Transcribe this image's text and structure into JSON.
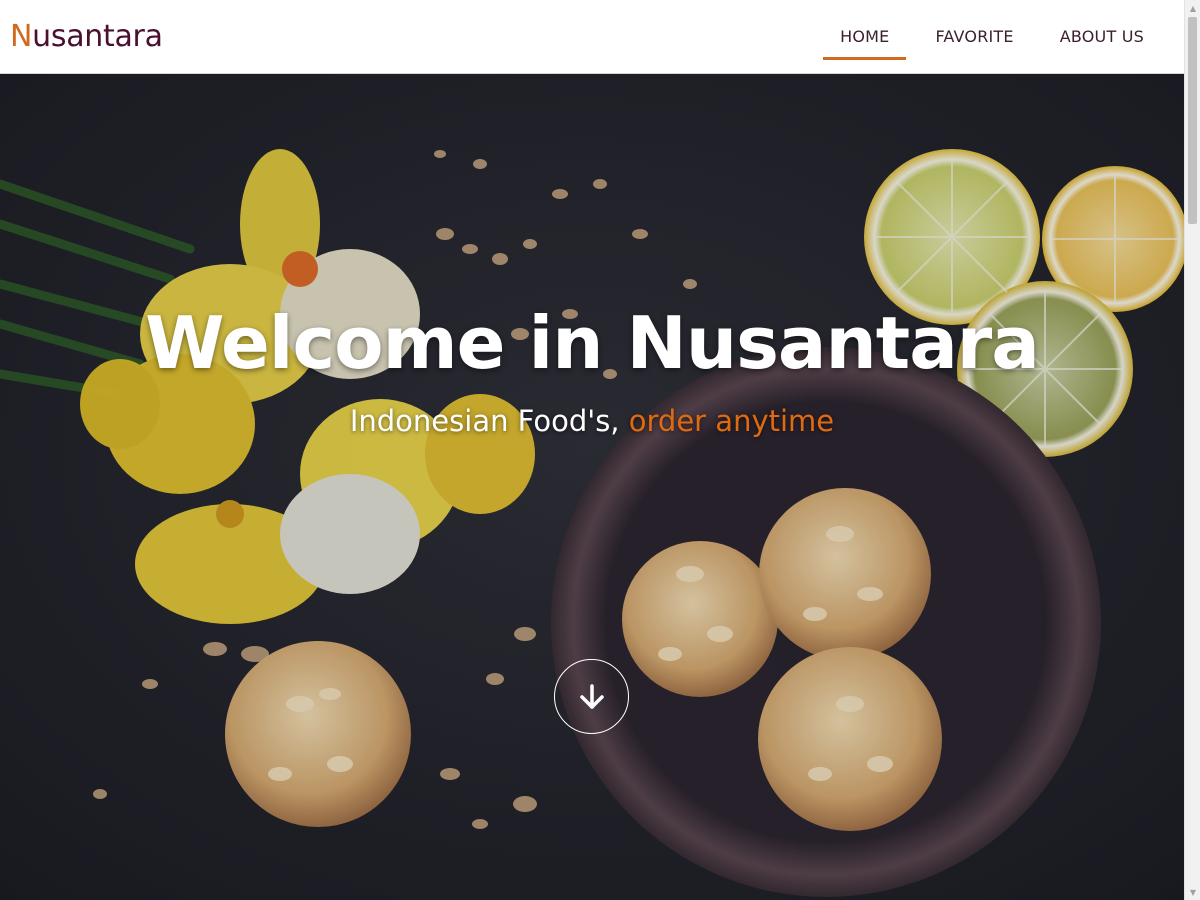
{
  "header": {
    "logo": {
      "first_letter": "N",
      "rest": "usantara"
    },
    "nav": [
      {
        "label": "HOME",
        "active": true
      },
      {
        "label": "FAVORITE",
        "active": false
      },
      {
        "label": "ABOUT US",
        "active": false
      }
    ]
  },
  "hero": {
    "title": "Welcome in Nusantara",
    "subtitle": "Indonesian Food's,",
    "subtitle_accent": "order anytime",
    "scroll_icon": "arrow-down-icon"
  },
  "colors": {
    "accent": "#d2691e",
    "logo_text": "#4a1030",
    "hero_background": "#24242e"
  }
}
